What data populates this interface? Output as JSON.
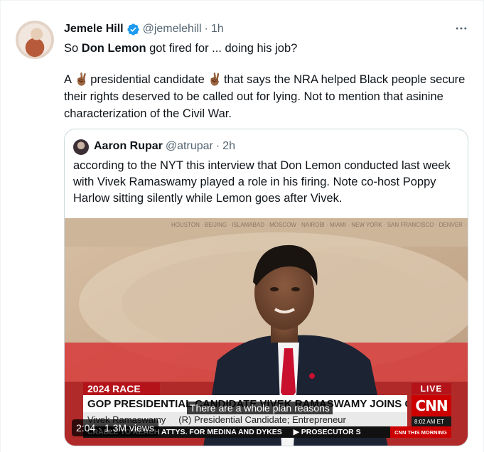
{
  "tweet": {
    "author": {
      "display_name": "Jemele Hill",
      "handle": "@jemelehill",
      "separator": "·",
      "time": "1h",
      "verified": true
    },
    "more_icon": "more-horizontal-icon",
    "text": {
      "line1_prefix": "So ",
      "line1_bold": "Don Lemon",
      "line1_suffix": " got fired for ... doing his job?",
      "para2_a": "A ",
      "emoji": "✌🏾",
      "para2_b": " presidential candidate ",
      "para2_c": " that says the NRA helped Black people secure their rights deserved to be called out for lying. Not to mention that asinine characterization of the Civil War."
    }
  },
  "quoted_tweet": {
    "display_name": "Aaron Rupar",
    "handle": "@atrupar",
    "separator": "·",
    "time": "2h",
    "text": "according to the NYT this interview that Don Lemon conducted last week with Vivek Ramaswamy played a role in his firing. Note co-host Poppy Harlow sitting silently while Lemon goes after Vivek.",
    "video": {
      "caption": "There are a whole plan reasons",
      "chyron_race": "2024 RACE",
      "chyron_headline": "GOP PRESIDENTIAL CANDIDATE VIVEK RAMASWAMY JOINS CNN THIS MORNING",
      "chyron_name": "Vivek Ramaswamy",
      "chyron_title": "(R) Presidential Candidate; Entrepreneur",
      "live_label": "LIVE",
      "network": "CNN",
      "clock": "8:02 AM ET",
      "ticker_a": "CRABLE TO REACH ATTYS. FOR MEDINA AND DYKES",
      "ticker_b": "▶ PROSECUTOR S",
      "show_name": "CNN THIS MORNING",
      "duration": "2:04",
      "views_separator": "·",
      "views": "1.3M views",
      "background_cities": "HOUSTON · BEIJING · ISLAMABAD · MOSCOW · NAIROBI · MIAMI · NEW YORK · SAN FRANCISCO · DENVER · LOS ANGELES · ABU DHABI · HONG KONG · LONDON · MEXICO CITY"
    }
  },
  "colors": {
    "text_primary": "#0f1419",
    "text_secondary": "#536471",
    "verified_blue": "#1d9bf0",
    "border": "#cfd9de",
    "cnn_red": "#cc0000"
  }
}
